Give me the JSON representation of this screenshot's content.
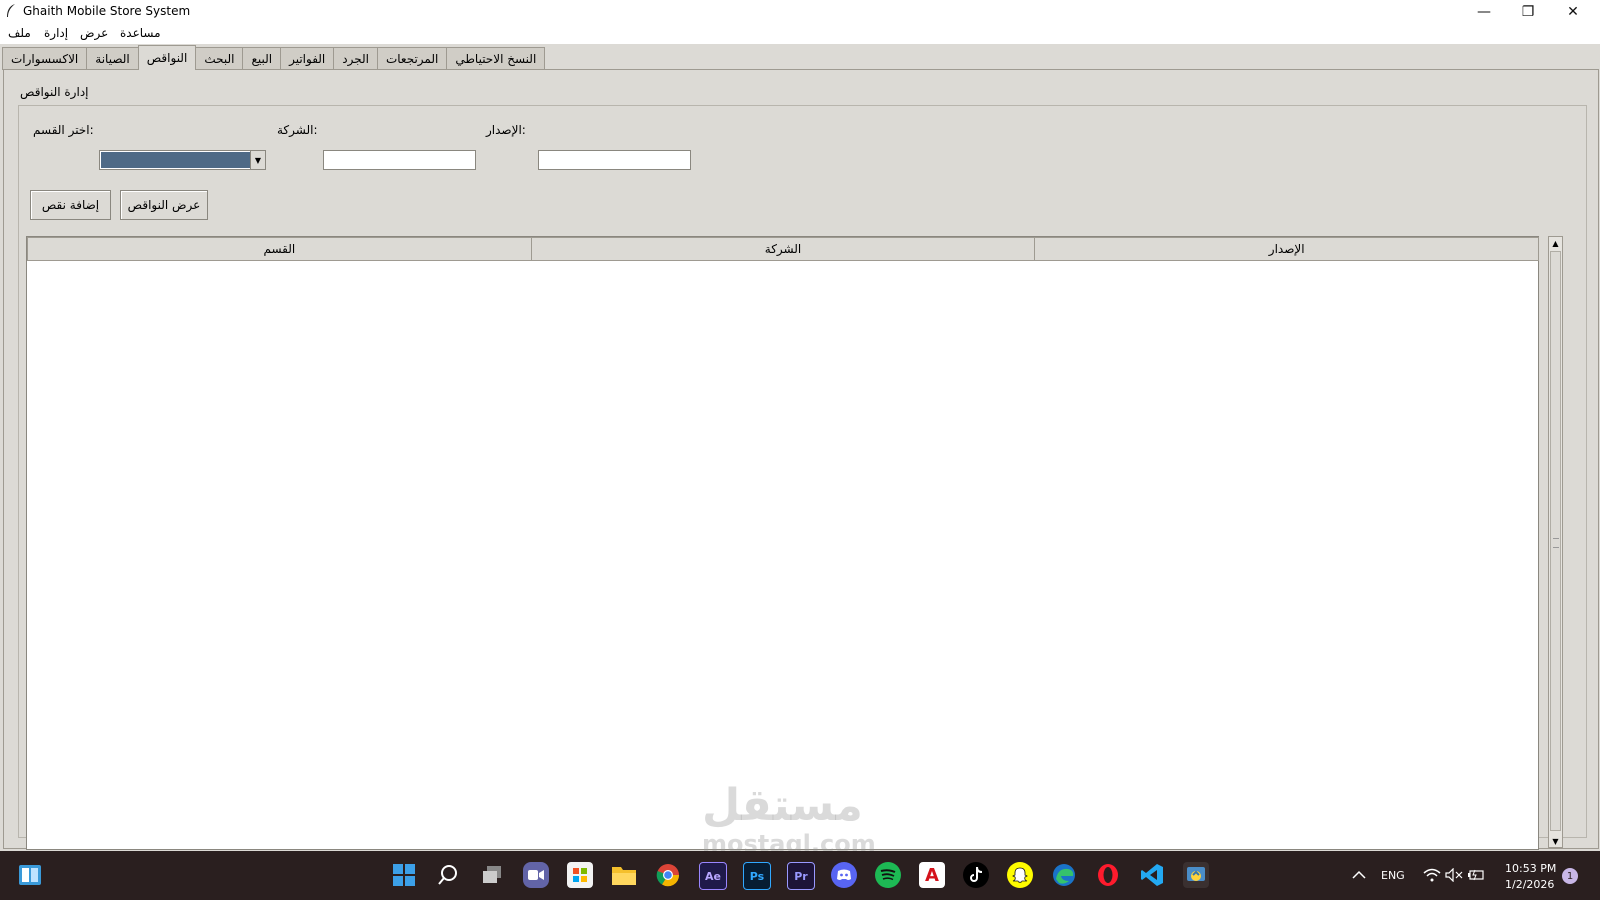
{
  "window": {
    "title": "Ghaith Mobile Store System",
    "minimize_glyph": "—",
    "maximize_glyph": "❐",
    "close_glyph": "✕"
  },
  "menu": [
    "مساعدة",
    "عرض",
    "إدارة",
    "ملف"
  ],
  "tabs": {
    "items": [
      "الاكسسوارات",
      "الصيانة",
      "النواقص",
      "البحث",
      "البيع",
      "الفواتير",
      "الجرد",
      "المرتجعات",
      "النسخ الاحتياطي"
    ],
    "active": "النواقص"
  },
  "frame": {
    "title": "إدارة النواقص",
    "labels": {
      "category": "اختر القسم:",
      "company": "الشركة:",
      "version": "الإصدار:"
    },
    "inputs": {
      "category_value": "",
      "company_value": "",
      "version_value": ""
    },
    "buttons": {
      "add": "إضافة نقص",
      "show": "عرض النواقص"
    },
    "table": {
      "columns": [
        "القسم",
        "الشركة",
        "الإصدار"
      ],
      "rows": []
    }
  },
  "watermark": {
    "text": "مستقل",
    "subtext": "mostaql.com"
  },
  "taskbar": {
    "apps": [
      "windows-start-icon",
      "search-icon",
      "task-view-icon",
      "teams-icon",
      "store-icon",
      "file-explorer-icon",
      "chrome-icon",
      "after-effects-icon",
      "photoshop-icon",
      "premiere-icon",
      "discord-icon",
      "spotify-icon",
      "acrobat-icon",
      "tiktok-icon",
      "snapchat-icon",
      "edge-icon",
      "opera-icon",
      "vscode-icon",
      "python-icon"
    ],
    "icon_labels": {
      "after_effects": "Ae",
      "photoshop": "Ps",
      "premiere": "Pr",
      "acrobat": "A"
    },
    "language": "ENG",
    "time": "10:53 PM",
    "date": "1/2/2026",
    "notifications": "1"
  }
}
